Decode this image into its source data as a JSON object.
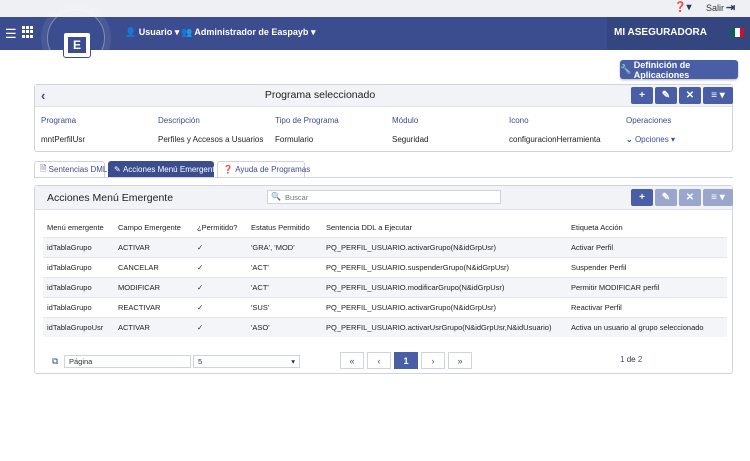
{
  "topbar": {
    "help_icon": "help-icon",
    "salir_label": "Salir",
    "exit_icon": "exit-icon"
  },
  "navbar": {
    "logo_letter": "E",
    "user_label": "Usuario",
    "admin_label": "Administrador de Easpayb",
    "company": "MI ASEGURADORA",
    "colors": {
      "primary": "#3b4d8f",
      "right": "#34467f"
    }
  },
  "actions": {
    "def_apps_label": "Definición de Aplicaciones"
  },
  "programa": {
    "title": "Programa seleccionado",
    "fields": [
      {
        "label": "Programa",
        "value": "mntPerfilUsr"
      },
      {
        "label": "Descripción",
        "value": "Perfiles y Accesos a Usuarios"
      },
      {
        "label": "Tipo de Programa",
        "value": "Formulario"
      },
      {
        "label": "Módulo",
        "value": "Seguridad"
      },
      {
        "label": "Icono",
        "value": "configuracionHerramienta"
      },
      {
        "label": "Operaciones",
        "value": "Opciones"
      }
    ]
  },
  "tabs": [
    {
      "label": "Sentencias DML"
    },
    {
      "label": "Acciones Menú Emergente"
    },
    {
      "label": "Ayuda de Programas"
    }
  ],
  "menu": {
    "title": "Acciones Menú Emergente",
    "search_placeholder": "Buscar",
    "columns": [
      "Menú emergente",
      "Campo Emergente",
      "¿Permitido?",
      "Estatus Permitido",
      "Sentencia DDL a Ejecutar",
      "Etiqueta Acción"
    ],
    "rows": [
      {
        "menu": "idTablaGrupo",
        "campo": "ACTIVAR",
        "permitido": "✓",
        "estatus": "'GRA', 'MOD'",
        "sentencia": "PQ_PERFIL_USUARIO.activarGrupo(N&idGrpUsr)",
        "etiqueta": "Activar Perfil"
      },
      {
        "menu": "idTablaGrupo",
        "campo": "CANCELAR",
        "permitido": "✓",
        "estatus": "'ACT'",
        "sentencia": "PQ_PERFIL_USUARIO.suspenderGrupo(N&idGrpUsr)",
        "etiqueta": "Suspender Perfil"
      },
      {
        "menu": "idTablaGrupo",
        "campo": "MODIFICAR",
        "permitido": "✓",
        "estatus": "'ACT'",
        "sentencia": "PQ_PERFIL_USUARIO.modificarGrupo(N&idGrpUsr)",
        "etiqueta": "Permitir MODIFICAR perfil"
      },
      {
        "menu": "idTablaGrupo",
        "campo": "REACTIVAR",
        "permitido": "✓",
        "estatus": "'SUS'",
        "sentencia": "PQ_PERFIL_USUARIO.activarGrupo(N&idGrpUsr)",
        "etiqueta": "Reactivar Perfil"
      },
      {
        "menu": "idTablaGrupoUsr",
        "campo": "ACTIVAR",
        "permitido": "✓",
        "estatus": "'ASO'",
        "sentencia": "PQ_PERFIL_USUARIO.activarUsrGrupo(N&idGrpUsr,N&idUsuario)",
        "etiqueta": "Activa un usuario al grupo seleccionado"
      }
    ]
  },
  "pager": {
    "page_placeholder": "Página",
    "page_size": "5",
    "first": "«",
    "prev": "‹",
    "current": "1",
    "next": "›",
    "last": "»",
    "count_current": "1",
    "count_of": "de",
    "count_total": "2"
  }
}
